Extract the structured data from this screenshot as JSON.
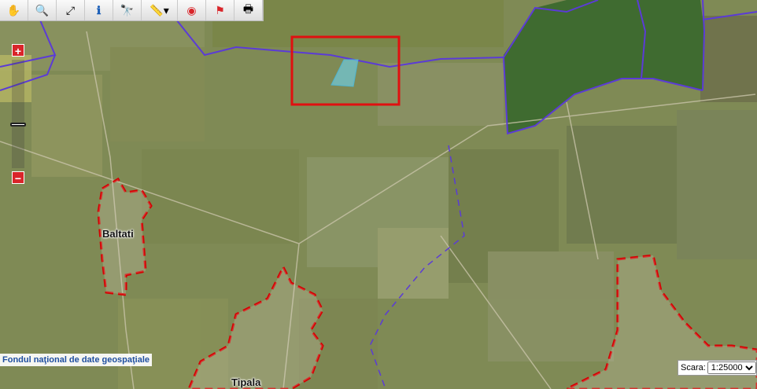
{
  "toolbar": {
    "tools": [
      {
        "name": "pan-hand-icon",
        "glyph": "✋"
      },
      {
        "name": "zoom-magnifier-icon",
        "glyph": "🔍"
      },
      {
        "name": "full-extent-icon",
        "glyph": "⤢"
      },
      {
        "name": "info-icon",
        "glyph": "ℹ"
      },
      {
        "name": "binoculars-icon",
        "glyph": "🔭"
      },
      {
        "name": "measure-ruler-icon",
        "glyph": "📏▾"
      },
      {
        "name": "target-icon",
        "glyph": "◉"
      },
      {
        "name": "flag-icon",
        "glyph": "⚑"
      },
      {
        "name": "print-icon",
        "glyph": "🖶"
      }
    ]
  },
  "zoom": {
    "in_label": "+",
    "out_label": "−"
  },
  "labels": {
    "baltati": "Baltati",
    "tipala": "Tipala"
  },
  "attribution": "Fondul naţional de date geospaţiale",
  "scale": {
    "label": "Scara:",
    "options": [
      "1:25000"
    ],
    "selected": "1:25000"
  },
  "colors": {
    "boundary": "#5b3bd6",
    "settlement": "#d40000",
    "highlight": "#e01010",
    "parcel": "#6fd0e8",
    "farmland": "#7d8a52",
    "forest": "#3b6a2e"
  }
}
